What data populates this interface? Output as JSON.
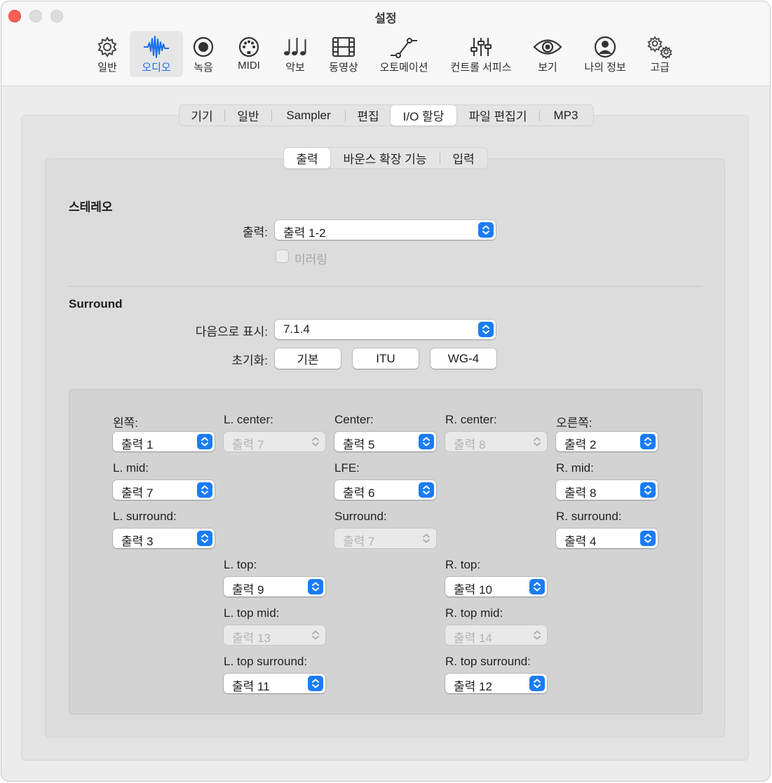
{
  "window": {
    "title": "설정"
  },
  "toolbar": {
    "items": [
      {
        "label": "일반",
        "icon": "gear-icon"
      },
      {
        "label": "오디오",
        "icon": "waveform-icon",
        "active": true
      },
      {
        "label": "녹음",
        "icon": "record-icon"
      },
      {
        "label": "MIDI",
        "icon": "midi-connector-icon"
      },
      {
        "label": "악보",
        "icon": "music-notes-icon"
      },
      {
        "label": "동영상",
        "icon": "film-icon"
      },
      {
        "label": "오토메이션",
        "icon": "automation-curve-icon"
      },
      {
        "label": "컨트롤 서피스",
        "icon": "sliders-icon"
      },
      {
        "label": "보기",
        "icon": "eye-icon"
      },
      {
        "label": "나의 정보",
        "icon": "person-icon"
      },
      {
        "label": "고급",
        "icon": "gears-icon"
      }
    ]
  },
  "tabs": [
    "기기",
    "일반",
    "Sampler",
    "편집",
    "I/O 할당",
    "파일 편집기",
    "MP3"
  ],
  "subtabs": [
    "출력",
    "바운스 확장 기능",
    "입력"
  ],
  "stereo": {
    "heading": "스테레오",
    "output_label": "출력:",
    "output_value": "출력 1-2",
    "mirroring_label": "미러링"
  },
  "surround": {
    "heading": "Surround",
    "display_label": "다음으로 표시:",
    "display_value": "7.1.4",
    "init_label": "초기화:",
    "buttons": [
      "기본",
      "ITU",
      "WG-4"
    ]
  },
  "channels": [
    {
      "label": "왼쪽:",
      "value": "출력 1",
      "enabled": true
    },
    {
      "label": "L. center:",
      "value": "출력 7",
      "enabled": false
    },
    {
      "label": "Center:",
      "value": "출력 5",
      "enabled": true
    },
    {
      "label": "R. center:",
      "value": "출력 8",
      "enabled": false
    },
    {
      "label": "오른쪽:",
      "value": "출력 2",
      "enabled": true
    },
    {
      "label": "L. mid:",
      "value": "출력 7",
      "enabled": true
    },
    {
      "label": "LFE:",
      "value": "출력 6",
      "enabled": true
    },
    {
      "label": "R. mid:",
      "value": "출력 8",
      "enabled": true
    },
    {
      "label": "L. surround:",
      "value": "출력 3",
      "enabled": true
    },
    {
      "label": "Surround:",
      "value": "출력 7",
      "enabled": false
    },
    {
      "label": "R. surround:",
      "value": "출력 4",
      "enabled": true
    },
    {
      "label": "L. top:",
      "value": "출력 9",
      "enabled": true
    },
    {
      "label": "R. top:",
      "value": "출력 10",
      "enabled": true
    },
    {
      "label": "L. top mid:",
      "value": "출력 13",
      "enabled": false
    },
    {
      "label": "R. top mid:",
      "value": "출력 14",
      "enabled": false
    },
    {
      "label": "L. top surround:",
      "value": "출력 11",
      "enabled": true
    },
    {
      "label": "R. top surround:",
      "value": "출력 12",
      "enabled": true
    }
  ],
  "colors": {
    "accent": "#1a7cf5",
    "window_bg": "#ececec"
  }
}
